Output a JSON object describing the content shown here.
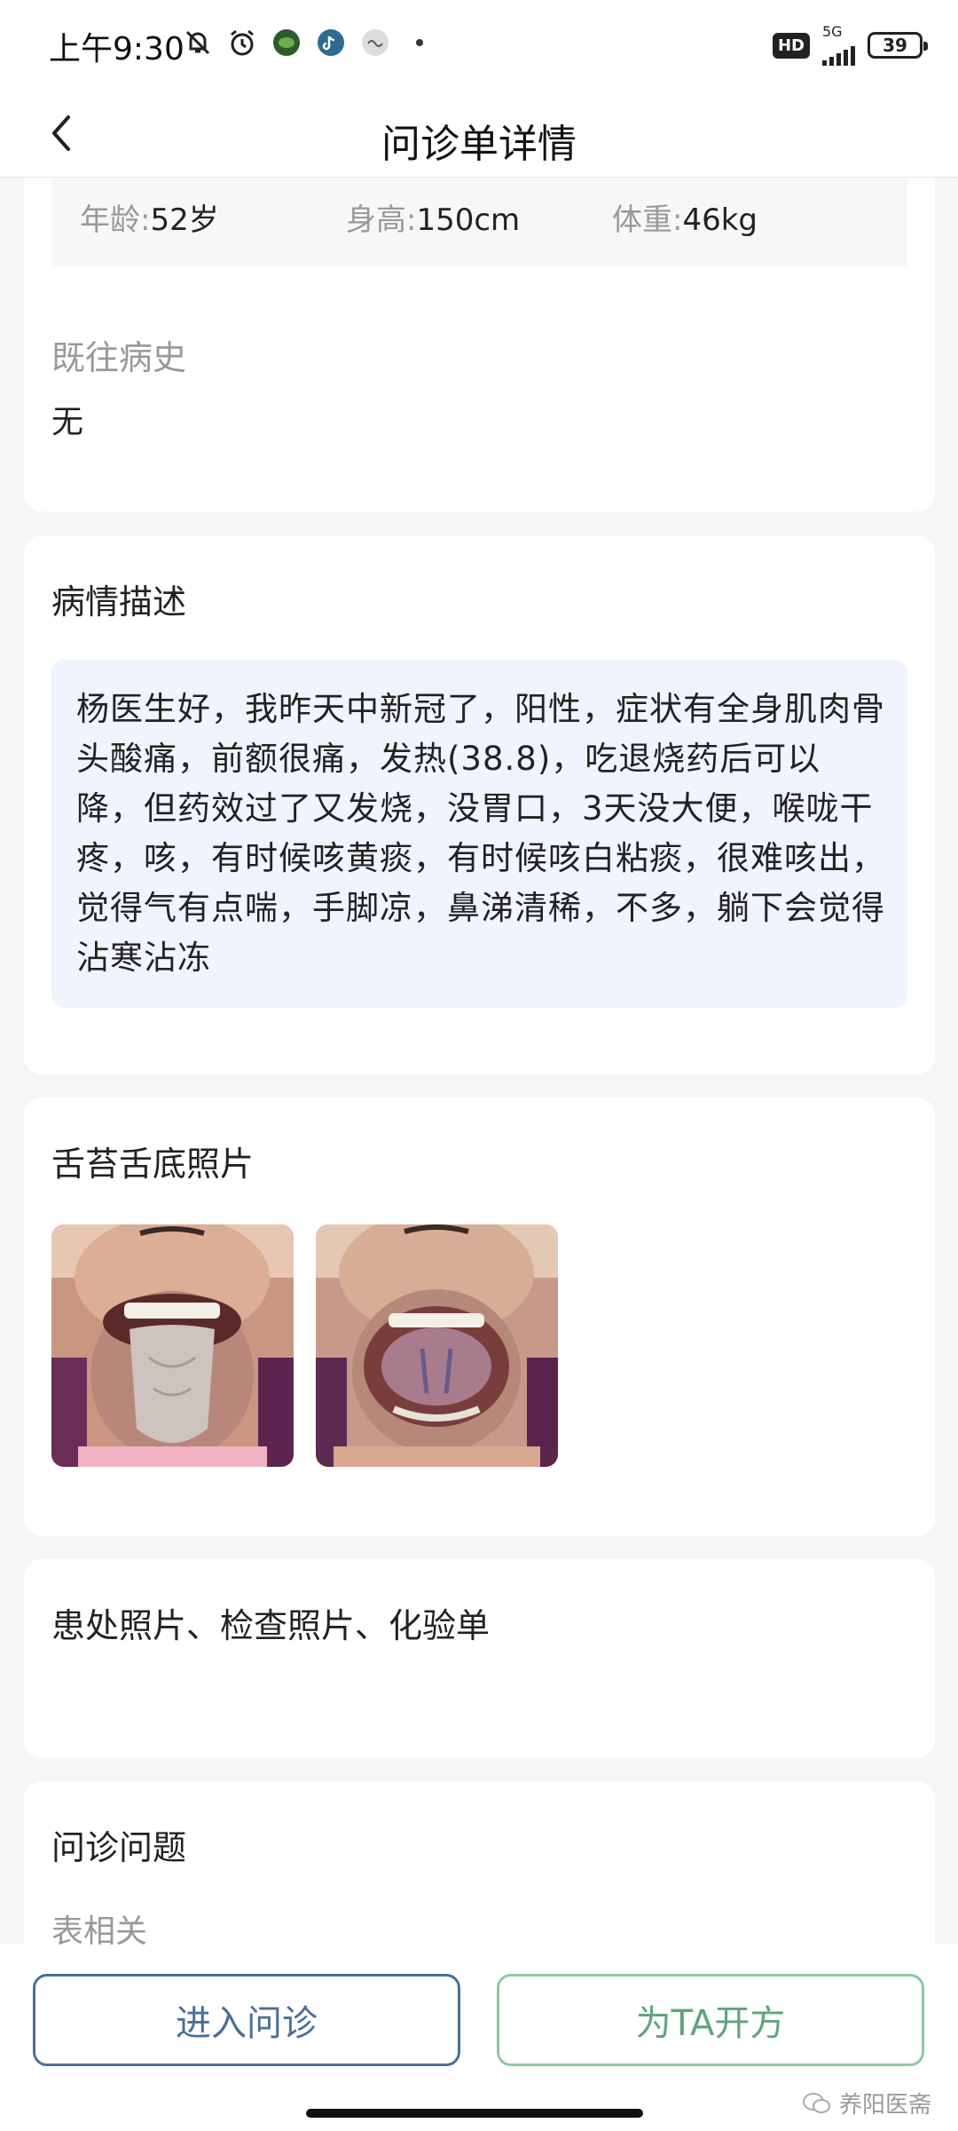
{
  "status_bar": {
    "time": "上午9:30",
    "hd": "HD",
    "network": "5G",
    "battery": "39"
  },
  "nav": {
    "title": "问诊单详情"
  },
  "patient": {
    "age_label": "年龄:",
    "age_value": "52岁",
    "height_label": "身高:",
    "height_value": "150cm",
    "weight_label": "体重:",
    "weight_value": "46kg",
    "history_label": "既往病史",
    "history_value": "无"
  },
  "description": {
    "title": "病情描述",
    "text": "杨医生好，我昨天中新冠了，阳性，症状有全身肌肉骨头酸痛，前额很痛，发热(38.8)，吃退烧药后可以降，但药效过了又发烧，没胃口，3天没大便，喉咙干疼，咳，有时候咳黄痰，有时候咳白粘痰，很难咳出，觉得气有点喘，手脚凉，鼻涕清稀，不多，躺下会觉得沾寒沾冻"
  },
  "tongue_photos": {
    "title": "舌苔舌底照片"
  },
  "exam_photos": {
    "title": "患处照片、检查照片、化验单"
  },
  "questions": {
    "title": "问诊问题",
    "first_item": "表相关"
  },
  "actions": {
    "consult": "进入问诊",
    "prescribe": "为TA开方"
  },
  "watermark": "养阳医斋",
  "colors": {
    "consult_button": "#4a6f9a",
    "prescribe_button": "#5fa57b",
    "description_bg": "#f0f4fc"
  }
}
